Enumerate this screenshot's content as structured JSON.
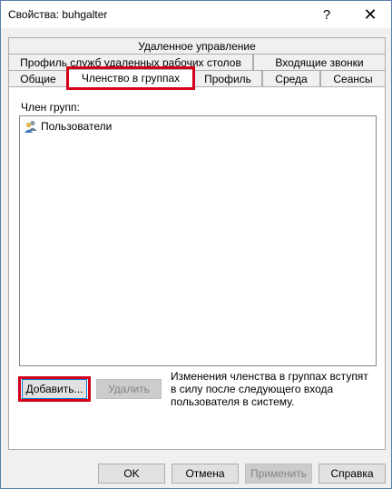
{
  "window": {
    "title": "Свойства: buhgalter",
    "help_glyph": "?",
    "close_glyph": "✕"
  },
  "tabs": {
    "row1": [
      "Удаленное управление"
    ],
    "row2": [
      "Профиль служб удаленных рабочих столов",
      "Входящие звонки"
    ],
    "row3": [
      "Общие",
      "Членство в группах",
      "Профиль",
      "Среда",
      "Сеансы"
    ],
    "active": "Членство в группах"
  },
  "panel": {
    "member_of_label": "Член групп:",
    "groups": [
      {
        "name": "Пользователи",
        "icon": "users-group-icon"
      }
    ],
    "add_button": "Добавить...",
    "remove_button": "Удалить",
    "note": "Изменения членства в группах вступят в силу после следующего входа пользователя в систему."
  },
  "footer": {
    "ok": "OK",
    "cancel": "Отмена",
    "apply": "Применить",
    "help": "Справка"
  },
  "colors": {
    "highlight": "#d4001a",
    "focus": "#0078d7"
  }
}
